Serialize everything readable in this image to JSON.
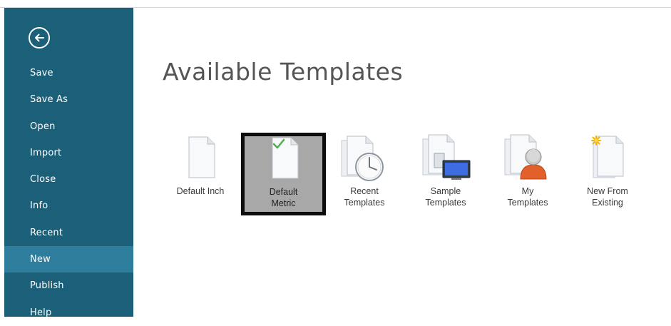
{
  "sidebar": {
    "back_icon": "back-arrow-icon",
    "items": [
      {
        "label": "Save"
      },
      {
        "label": "Save As"
      },
      {
        "label": "Open"
      },
      {
        "label": "Import"
      },
      {
        "label": "Close"
      },
      {
        "label": "Info"
      },
      {
        "label": "Recent"
      },
      {
        "label": "New",
        "active": true
      },
      {
        "label": "Publish"
      },
      {
        "label": "Help"
      }
    ]
  },
  "main": {
    "title": "Available Templates",
    "templates": [
      {
        "label": "Default Inch",
        "icon": "blank-document-icon"
      },
      {
        "label": "Default\nMetric",
        "icon": "checked-document-icon",
        "selected": true
      },
      {
        "label": "Recent\nTemplates",
        "icon": "clock-documents-icon"
      },
      {
        "label": "Sample\nTemplates",
        "icon": "monitor-documents-icon"
      },
      {
        "label": "My\nTemplates",
        "icon": "user-documents-icon"
      },
      {
        "label": "New From\nExisting",
        "icon": "sparkle-document-icon"
      }
    ]
  },
  "colors": {
    "sidebar_bg": "#1b5f79",
    "sidebar_active": "#2f7d9c",
    "selected_tile_bg": "#a8a8a8",
    "selected_tile_border": "#0d0d0d"
  }
}
